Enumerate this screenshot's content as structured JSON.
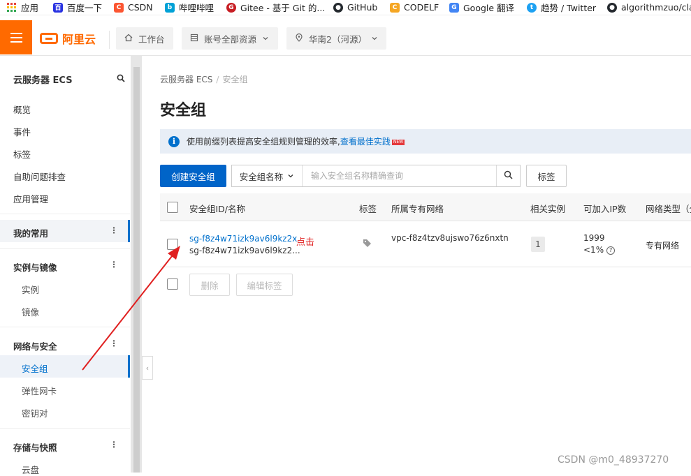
{
  "bookmarks": [
    {
      "label": "应用",
      "icon": "apps-grid-icon",
      "color": "#e8453c"
    },
    {
      "label": "百度一下",
      "icon": "baidu-icon",
      "color": "#2932e1"
    },
    {
      "label": "CSDN",
      "icon": "csdn-icon",
      "color": "#fc5531"
    },
    {
      "label": "哔哩哔哩",
      "icon": "bilibili-icon",
      "color": "#00a1d6"
    },
    {
      "label": "Gitee - 基于 Git 的...",
      "icon": "gitee-icon",
      "color": "#c71d23"
    },
    {
      "label": "GitHub",
      "icon": "github-icon",
      "color": "#24292e"
    },
    {
      "label": "CODELF",
      "icon": "codelf-icon",
      "color": "#f5a623"
    },
    {
      "label": "Google 翻译",
      "icon": "google-translate-icon",
      "color": "#4285f4"
    },
    {
      "label": "趋势 / Twitter",
      "icon": "twitter-icon",
      "color": "#1da1f2"
    },
    {
      "label": "algorithmzuo/cla",
      "icon": "github-icon",
      "color": "#24292e"
    }
  ],
  "header": {
    "logo_text": "阿里云",
    "workbench": "工作台",
    "resources": "账号全部资源",
    "region": "华南2（河源）",
    "brand_color": "#ff6a00"
  },
  "sidebar": {
    "title": "云服务器 ECS",
    "top_items": [
      "概览",
      "事件",
      "标签",
      "自助问题排查",
      "应用管理"
    ],
    "favorites": "我的常用",
    "group_instances": "实例与镜像",
    "instances_items": [
      "实例",
      "镜像"
    ],
    "group_network": "网络与安全",
    "network_items": [
      "安全组",
      "弹性网卡",
      "密钥对"
    ],
    "group_storage": "存储与快照",
    "storage_items": [
      "云盘"
    ]
  },
  "breadcrumb": {
    "root": "云服务器 ECS",
    "separator": "/",
    "current": "安全组"
  },
  "page_title": "安全组",
  "notice": {
    "text": "使用前缀列表提高安全组规则管理的效率,",
    "link": "查看最佳实践",
    "badge": "NEW"
  },
  "toolbar": {
    "create_button": "创建安全组",
    "search_field": "安全组名称",
    "search_placeholder": "输入安全组名称精确查询",
    "tag_button": "标签"
  },
  "table": {
    "columns": [
      "安全组ID/名称",
      "标签",
      "所属专有网络",
      "相关实例",
      "可加入IP数",
      "网络类型（全"
    ],
    "rows": [
      {
        "id": "sg-f8z4w71izk9av6l9kz2x",
        "name": "sg-f8z4w71izk9av6l9kz2...",
        "vpc": "vpc-f8z4tzv8ujswo76z6nxtn",
        "instances": "1",
        "ip_count": "1999",
        "ip_percent": "<1%",
        "network_type": "专有网络"
      }
    ],
    "delete_button": "删除",
    "edit_tags_button": "编辑标签"
  },
  "annotation": "点击",
  "watermark": "CSDN @m0_48937270"
}
